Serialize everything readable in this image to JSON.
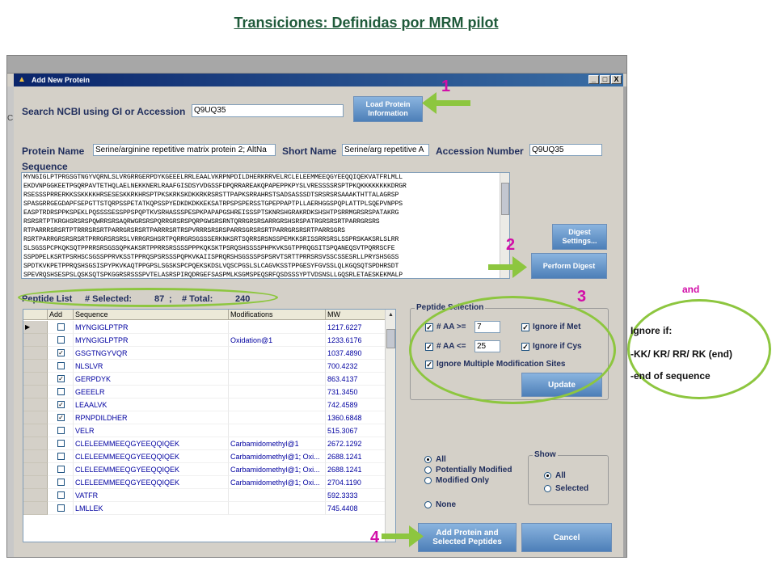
{
  "slide": {
    "title": "Transiciones: Definidas por MRM pilot",
    "annotations": [
      "1",
      "2",
      "3",
      "4"
    ],
    "and_label": "and",
    "ignore_title": "Ignore if:",
    "ignore_line1": "-KK/ KR/ RR/ RK (end)",
    "ignore_line2": "-end of sequence"
  },
  "window": {
    "title": "Add New Protein",
    "left_char": "C",
    "controls": [
      "_",
      "□",
      "X"
    ]
  },
  "search": {
    "label": "Search NCBI using GI or Accession",
    "value": "Q9UQ35",
    "load_button": "Load Protein Information"
  },
  "protein": {
    "name_label": "Protein Name",
    "name_value": "Serine/arginine repetitive matrix protein 2; AltNa",
    "short_label": "Short Name",
    "short_value": "Serine/arg repetitive A",
    "accession_label": "Accession Number",
    "accession_value": "Q9UQ35"
  },
  "sequence": {
    "label": "Sequence",
    "lines": [
      "MYNGIGLPTPRGSGTNGYVQRNLSLVRGRRGERPDYKGEEELRRLEAALVKRPNPDILDHERKRRVELRCLELEEMMEEQGYEEQQIQEKVATFRLMLL",
      "EKDVNPGGKEETPGQRPAVTETHQLAELNEKKNERLRAAFGISDSYVDGSSFDPQRRAREAKQPAPEPPKPYSLVRESSSSRSPTPKQKKKKKKKKDRGR",
      "RSESSSPRRERKKSSKKKKHRSESESKKRKHRSPTPKSKRKSKDKKRKRSRSTTPAPKSRRAHRSTSADSASSSDTSRSRSRSAAAKTHTTALAGRSP",
      "SPASGRRGEGDAPFSEPGTTSTQRPSSPETATKQPSSPYEDKDKDKKEKSATRPSPSPERSSTGPEPPAPTPLLAERHGGSPQPLATTPLSQEPVNPPS",
      "EASPTRDRSPPKSPEKLPQSSSSESSPPSPQPTKVSRHASSSPESPKPAPAPGSHREISSSPTSKNRSHGRAKRDKSHSHTPSRRMGRSRSPATAKRG",
      "RSRSRTPTKRGHSRSRSPQWRRSRSAQRWGRSRSPQRRGRSRSPQRPGWSRSRNTQRRGRSRSARRGRSHSRSPATRGRSRSRTPARRGRSRS",
      "RTPARRRSRSRTPTRRRSRSRTPARRGRSRSRTPARRRSRTRSPVRRRSRSRSPARRSGRSRSRTPARRGRSRSRTPARRSGRS",
      "RSRTPARRGRSRSRSRTPRRGRSRSRSLVRRGRSHSRTPQRRGRSGSSSERKNKSRTSQRRSRSNSSPEMKKSRISSRRSRSLSSPRSKAKSRLSLRR",
      "SLSGSSPCPKQKSQTPPRRSRSGSSQPKAKSRTPPRRSRSSSSPPPKQKSKTPSRQSHSSSSPHPKVKSGTPPRQGSITSPQANEQSVTPQRRSCFE",
      "SSPDPELKSRTPSRHSCSGSSPPRVKSSTPPRQSPSRSSSPQPKVKAIISPRQRSHSGSSSPSPSRVTSRTTPRRSRSVSSCSSESRLLPRYSHSGSS",
      "SPDTKVKPETPPRQSHSGSISPYPKVKAQTPPGPSLSGSKSPCPQEKSKDSLVQSCPGSLSLCAGVKSSTPPGESYFGVSSLQLKGQSQTSPDHRSDT",
      "SPEVRQSHSESPSLQSKSQTSPKGGRSRSSSPVTELASRSPIRQDRGEFSASPMLKSGMSPEQSRFQSDSSSYPTVDSNSLLGQSRLETAESKEKMALP"
    ]
  },
  "digest": {
    "settings_button": "Digest Settings...",
    "perform_button": "Perform Digest"
  },
  "peptide_list": {
    "label": "Peptide List",
    "selected_label": "# Selected:",
    "selected_value": "87",
    "separator": ";",
    "total_label": "# Total:",
    "total_value": "240",
    "columns": [
      "Add",
      "Sequence",
      "Modifications",
      "MW"
    ],
    "rows": [
      {
        "add": false,
        "sequence": "MYNGIGLPTPR",
        "mod": "",
        "mw": "1217.6227",
        "current": true
      },
      {
        "add": false,
        "sequence": "MYNGIGLPTPR",
        "mod": "Oxidation@1",
        "mw": "1233.6176",
        "current": false
      },
      {
        "add": true,
        "sequence": "GSGTNGYVQR",
        "mod": "",
        "mw": "1037.4890",
        "current": false
      },
      {
        "add": false,
        "sequence": "NLSLVR",
        "mod": "",
        "mw": "700.4232",
        "current": false
      },
      {
        "add": true,
        "sequence": "GERPDYK",
        "mod": "",
        "mw": "863.4137",
        "current": false
      },
      {
        "add": false,
        "sequence": "GEEELR",
        "mod": "",
        "mw": "731.3450",
        "current": false
      },
      {
        "add": true,
        "sequence": "LEAALVK",
        "mod": "",
        "mw": "742.4589",
        "current": false
      },
      {
        "add": true,
        "sequence": "RPNPDILDHER",
        "mod": "",
        "mw": "1360.6848",
        "current": false
      },
      {
        "add": false,
        "sequence": "VELR",
        "mod": "",
        "mw": "515.3067",
        "current": false
      },
      {
        "add": false,
        "sequence": "CLELEEMMEEQGYEEQQIQEK",
        "mod": "Carbamidomethyl@1",
        "mw": "2672.1292",
        "current": false
      },
      {
        "add": false,
        "sequence": "CLELEEMMEEQGYEEQQIQEK",
        "mod": "Carbamidomethyl@1; Oxi...",
        "mw": "2688.1241",
        "current": false
      },
      {
        "add": false,
        "sequence": "CLELEEMMEEQGYEEQQIQEK",
        "mod": "Carbamidomethyl@1; Oxi...",
        "mw": "2688.1241",
        "current": false
      },
      {
        "add": false,
        "sequence": "CLELEEMMEEQGYEEQQIQEK",
        "mod": "Carbamidomethyl@1; Oxi...",
        "mw": "2704.1190",
        "current": false
      },
      {
        "add": false,
        "sequence": "VATFR",
        "mod": "",
        "mw": "592.3333",
        "current": false
      },
      {
        "add": false,
        "sequence": "LMLLEK",
        "mod": "",
        "mw": "745.4408",
        "current": false
      }
    ]
  },
  "peptide_selection": {
    "title": "Peptide Selection",
    "aa_min_label": "# AA >=",
    "aa_min_value": "7",
    "aa_max_label": "# AA <=",
    "aa_max_value": "25",
    "ignore_met": "Ignore if Met",
    "ignore_cys": "Ignore if Cys",
    "ignore_multi": "Ignore Multiple Modification Sites",
    "update_button": "Update"
  },
  "filter": {
    "all": "All",
    "potentially_modified": "Potentially Modified",
    "modified_only": "Modified Only",
    "none": "None",
    "show_title": "Show",
    "show_all": "All",
    "show_selected": "Selected"
  },
  "footer": {
    "add_button": "Add Protein and Selected Peptides",
    "cancel_button": "Cancel"
  },
  "colors": {
    "annotation_magenta": "#d20ea8",
    "annotation_green": "#8dc63f",
    "title_green": "#1f5a3a",
    "label_navy": "#1f2d5c"
  }
}
